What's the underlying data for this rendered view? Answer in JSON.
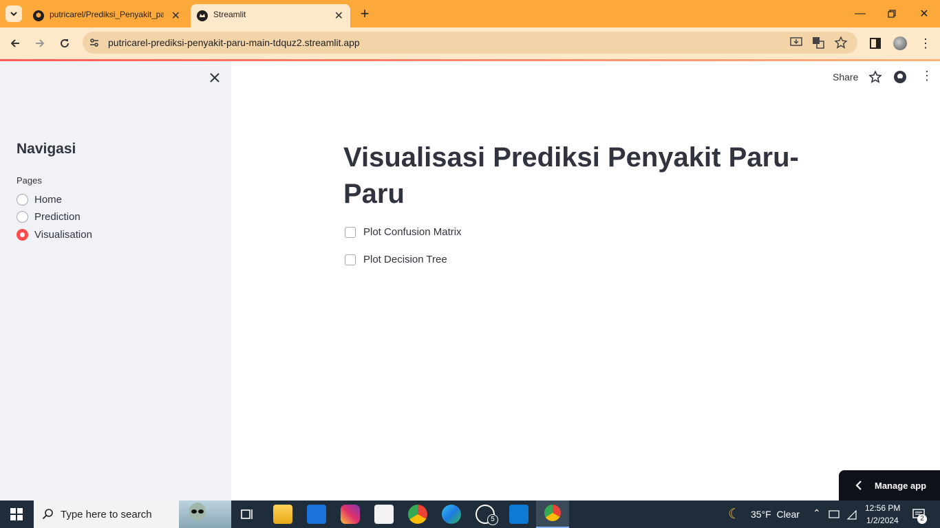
{
  "browser": {
    "tabs": [
      {
        "label": "putricarel/Prediksi_Penyakit_pa"
      },
      {
        "label": "Streamlit"
      }
    ],
    "url": "putricarel-prediksi-penyakit-paru-main-tdquz2.streamlit.app"
  },
  "app_header": {
    "share_label": "Share"
  },
  "sidebar": {
    "title": "Navigasi",
    "radio_label": "Pages",
    "options": [
      {
        "label": "Home",
        "selected": false
      },
      {
        "label": "Prediction",
        "selected": false
      },
      {
        "label": "Visualisation",
        "selected": true
      }
    ]
  },
  "main": {
    "title": "Visualisasi Prediksi Penyakit Paru-Paru",
    "checkboxes": [
      {
        "label": "Plot Confusion Matrix",
        "checked": false
      },
      {
        "label": "Plot Decision Tree",
        "checked": false
      }
    ],
    "manage_app_label": "Manage app"
  },
  "taskbar": {
    "search_placeholder": "Type here to search",
    "whatsapp_badge": "5",
    "weather": "35°F  Clear",
    "time": "12:56 PM",
    "date": "1/2/2024",
    "notification_count": "2"
  },
  "colors": {
    "accent": "#ff4b4b",
    "titlebar": "#fda83b",
    "toolbar": "#fde8c9",
    "sidebar_bg": "#f0f2f6",
    "taskbar": "#1f2d3a"
  }
}
